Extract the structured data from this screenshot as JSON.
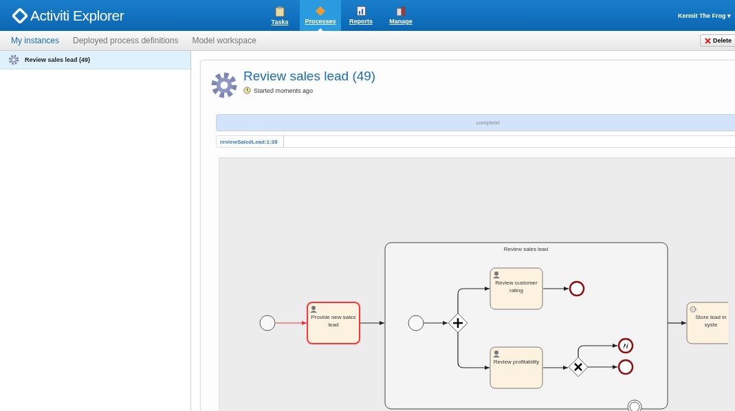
{
  "header": {
    "logo": "Activiti Explorer",
    "nav": [
      {
        "label": "Tasks",
        "selected": false
      },
      {
        "label": "Processes",
        "selected": true
      },
      {
        "label": "Reports",
        "selected": false
      },
      {
        "label": "Manage",
        "selected": false
      }
    ],
    "user": "Kermit The Frog",
    "user_caret": "▾"
  },
  "subnav": {
    "tabs": [
      {
        "label": "My instances",
        "selected": true
      },
      {
        "label": "Deployed process definitions",
        "selected": false
      },
      {
        "label": "Model workspace",
        "selected": false
      }
    ],
    "delete_button": "Delete"
  },
  "sidebar": {
    "items": [
      {
        "label": "Review sales lead (49)",
        "selected": true
      }
    ]
  },
  "detail": {
    "title": "Review sales lead (49)",
    "started": "Started moments ago",
    "progress": {
      "label": "complete!",
      "level": 1
    },
    "breadcrumb": "reviewSaledLead:1:38",
    "diagram": {
      "subprocess_label": "Review sales lead",
      "nodes": [
        {
          "kind": "start",
          "active": false
        },
        {
          "kind": "user_task",
          "label": "Provide new sales lead",
          "active": true
        },
        {
          "kind": "start",
          "active": false
        },
        {
          "kind": "parallel_gateway",
          "active": false
        },
        {
          "kind": "user_task",
          "label": "Review customer rating",
          "active": false
        },
        {
          "kind": "end",
          "active": false
        },
        {
          "kind": "user_task",
          "label": "Review profitability",
          "active": false
        },
        {
          "kind": "exclusive_gateway",
          "active": false
        },
        {
          "kind": "error_end",
          "active": false
        },
        {
          "kind": "end",
          "active": false
        },
        {
          "kind": "service_task",
          "label": "Store lead in syste",
          "active": false
        },
        {
          "kind": "boundary_event",
          "active": false
        }
      ]
    }
  }
}
